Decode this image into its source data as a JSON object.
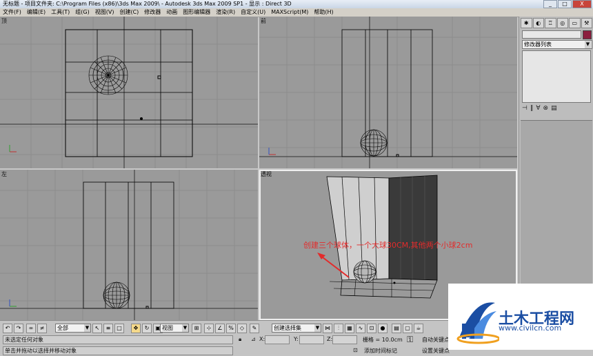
{
  "window": {
    "title": "无标题 - 项目文件夹: C:\\Program Files (x86)\\3ds Max 2009\\ - Autodesk 3ds Max 2009 SP1 - 显示 : Direct 3D",
    "buttons": [
      "_",
      "□",
      "X"
    ]
  },
  "menu": [
    "文件(F)",
    "编辑(E)",
    "工具(T)",
    "组(G)",
    "视图(V)",
    "创建(C)",
    "修改器",
    "动画",
    "图形编辑器",
    "渲染(R)",
    "自定义(U)",
    "MAXScript(M)",
    "帮助(H)"
  ],
  "viewports": {
    "top": {
      "label": "顶"
    },
    "front": {
      "label": "前"
    },
    "left": {
      "label": "左"
    },
    "perspective": {
      "label": "透视"
    }
  },
  "command_panel": {
    "tabs": [
      "create-tab",
      "modify-tab",
      "hierarchy-tab",
      "motion-tab",
      "display-tab",
      "utilities-tab"
    ],
    "modifier_list": "修改器列表",
    "object_color": "#8b1e3e"
  },
  "annotation": {
    "text": "创建三个球体，一个大球30CM,其他两个小球2cm",
    "color": "#e32b2b"
  },
  "toolbar": {
    "selection_filter": "全部",
    "ref_coord": "视图",
    "named_selection": "创建选择集"
  },
  "status": {
    "line1": "未选定任何对象",
    "line2": "单击并拖动以选择并移动对象",
    "x_label": "X:",
    "y_label": "Y:",
    "z_label": "Z:",
    "grid": "栅格 = 10.0cm",
    "add_time_tag": "添加时间标记",
    "auto_key": "自动关键点",
    "set_key": "设置关键点"
  },
  "watermark": {
    "brand": "土木工程网",
    "url": "www.civilcn.com"
  }
}
